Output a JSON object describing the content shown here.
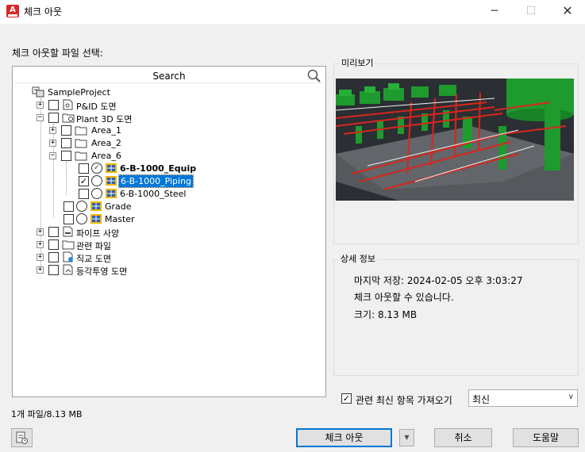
{
  "window": {
    "title": "체크 아웃",
    "minimize_icon": "─",
    "maximize_icon": "☐",
    "close_icon": "✕",
    "app_icon_letter": "A"
  },
  "main": {
    "select_label": "체크 아웃할 파일 선택:",
    "search": {
      "text": "Search"
    },
    "tree": {
      "root": "SampleProject",
      "pid": "P&ID 도면",
      "plant3d": "Plant 3D 도면",
      "area1": "Area_1",
      "area2": "Area_2",
      "area6": "Area_6",
      "equip": "6-B-1000_Equip",
      "piping": "6-B-1000_Piping",
      "steel": "6-B-1000_Steel",
      "grade": "Grade",
      "master": "Master",
      "pipe_spec": "파이프 사양",
      "related": "관련 파일",
      "ortho": "직교 도면",
      "iso": "등각투영 도면"
    },
    "status": "1개 파일/8.13 MB"
  },
  "preview": {
    "label": "미리보기"
  },
  "details": {
    "label": "상세 정보",
    "last_saved": "마지막 저장: 2024-02-05 오후 3:03:27",
    "can_checkout": "체크 아웃할 수 있습니다.",
    "size": "크기: 8.13 MB"
  },
  "options": {
    "get_latest_label": "관련 최신 항목 가져오기",
    "get_latest_checked": true,
    "version_selected": "최신"
  },
  "buttons": {
    "checkout": "체크 아웃",
    "cancel": "취소",
    "help": "도움말",
    "split_arrow": "▼"
  },
  "colors": {
    "selection": "#0078d7",
    "preview_bg": "#2b2e33",
    "equipment_green": "#1f9a2e",
    "piping_red": "#d9261c"
  }
}
